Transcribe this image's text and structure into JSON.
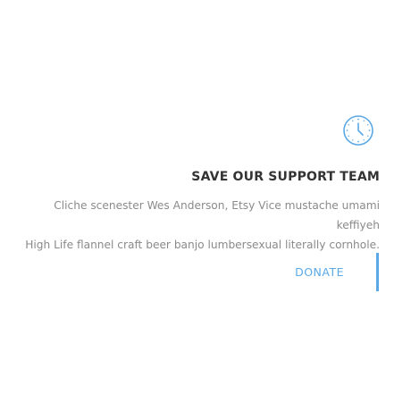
{
  "card": {
    "icon": "clock-icon",
    "title": "SAVE OUR SUPPORT TEAM",
    "description_lines": [
      "Cliche scenester Wes Anderson, Etsy Vice mustache umami keffiyeh",
      "High Life flannel craft beer banjo lumbersexual literally cornhole."
    ],
    "donate_label": "DONATE"
  },
  "colors": {
    "accent": "#5aa9e6",
    "title": "#333333",
    "text": "#8a8a8a",
    "background": "#ffffff"
  }
}
